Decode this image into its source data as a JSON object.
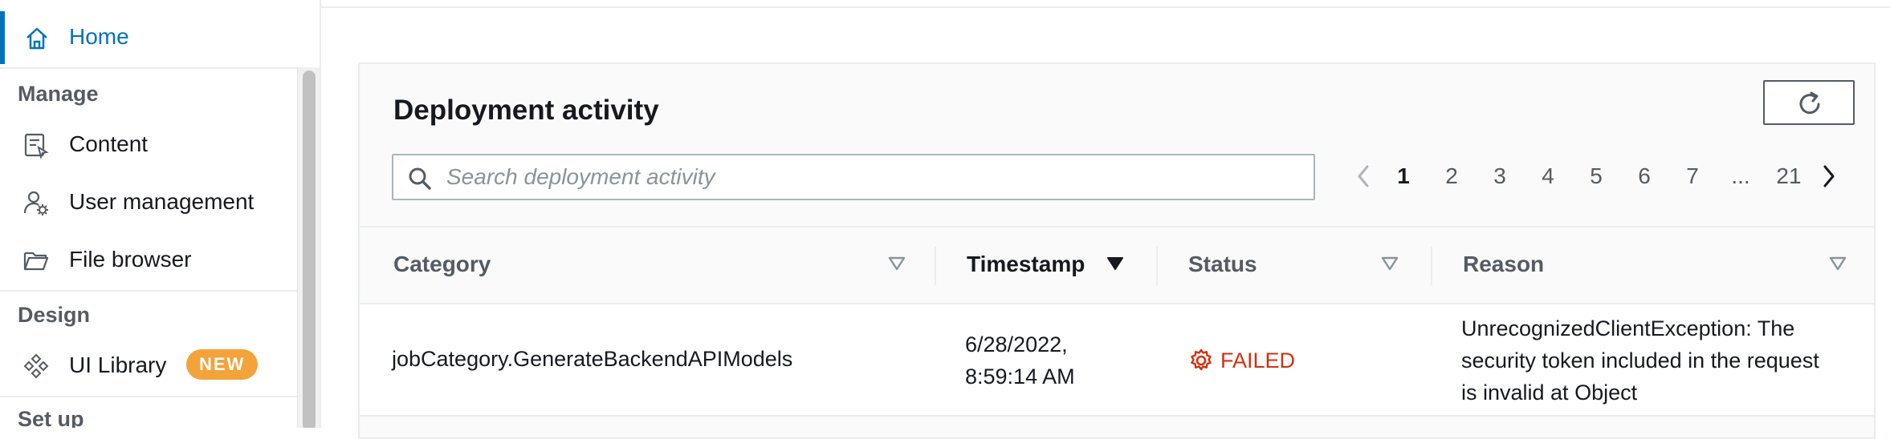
{
  "sidebar": {
    "home_label": "Home",
    "sections": {
      "manage": "Manage",
      "design": "Design",
      "setup": "Set up"
    },
    "items": {
      "content": "Content",
      "user_management": "User management",
      "file_browser": "File browser",
      "ui_library": "UI Library",
      "ui_library_badge": "NEW"
    },
    "accent_color": "#0073bb",
    "badge_color": "#f2a33a"
  },
  "panel": {
    "title": "Deployment activity",
    "search_placeholder": "Search deployment activity",
    "pagination": {
      "pages": [
        "1",
        "2",
        "3",
        "4",
        "5",
        "6",
        "7",
        "...",
        "21"
      ],
      "current": "1"
    },
    "table": {
      "columns": {
        "category": "Category",
        "timestamp": "Timestamp",
        "status": "Status",
        "reason": "Reason"
      },
      "rows": [
        {
          "category": "jobCategory.GenerateBackendAPIModels",
          "timestamp_line1": "6/28/2022,",
          "timestamp_line2": "8:59:14 AM",
          "status": "FAILED",
          "reason_line1": "UnrecognizedClientException: The",
          "reason_line2": "security token included in the request",
          "reason_line3": "is invalid at Object"
        }
      ]
    },
    "status_failed_color": "#d13212"
  }
}
